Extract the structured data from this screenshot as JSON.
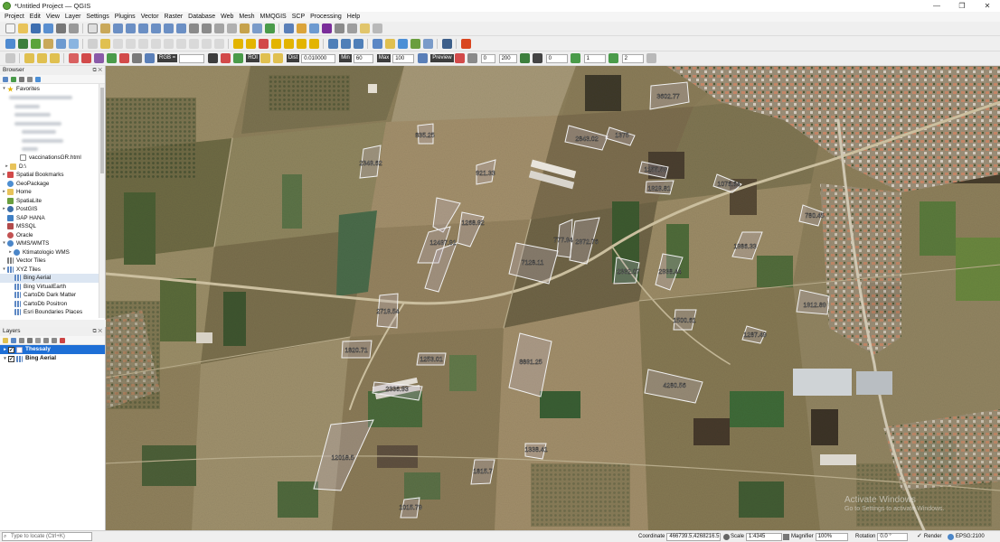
{
  "window": {
    "title": "*Untitled Project — QGIS",
    "controls": [
      "—",
      "❐",
      "✕"
    ]
  },
  "menu": [
    "Project",
    "Edit",
    "View",
    "Layer",
    "Settings",
    "Plugins",
    "Vector",
    "Raster",
    "Database",
    "Web",
    "Mesh",
    "MMQGIS",
    "SCP",
    "Processing",
    "Help"
  ],
  "scp_toolbar": {
    "band_set": "RGB =",
    "roi_label": "ROI",
    "dist_label": "Dist",
    "dist_value": "0.010000",
    "min_label": "Min",
    "min_value": "60",
    "max_label": "Max",
    "max_value": "100",
    "preview_label": "Preview",
    "val_a": "0",
    "val_b": "200",
    "val_c": "0",
    "val_d": "1",
    "val_e": "2"
  },
  "browser": {
    "title": "Browser",
    "items": [
      {
        "label": "Favorites",
        "level": 0,
        "expand": "▾",
        "icon": "star-icon",
        "color": "#e3b400"
      },
      {
        "label": "vaccinationsGR.html",
        "level": 2,
        "expand": "",
        "icon": "file-icon",
        "color": "#8a8a8a"
      },
      {
        "label": "D:\\",
        "level": 0,
        "expand": "▸",
        "icon": "folder-icon",
        "color": "#e8c35a"
      },
      {
        "label": "Spatial Bookmarks",
        "level": 0,
        "expand": "▸",
        "icon": "bookmark-icon",
        "color": "#d24a4a"
      },
      {
        "label": "GeoPackage",
        "level": 0,
        "expand": "",
        "icon": "geopackage-icon",
        "color": "#4d8ed1"
      },
      {
        "label": "Home",
        "level": 0,
        "expand": "▸",
        "icon": "folder-icon",
        "color": "#e8c35a"
      },
      {
        "label": "SpatiaLite",
        "level": 0,
        "expand": "",
        "icon": "spatialite-icon",
        "color": "#6a9e3f"
      },
      {
        "label": "PostGIS",
        "level": 0,
        "expand": "▸",
        "icon": "postgis-icon",
        "color": "#3d6fa8"
      },
      {
        "label": "SAP HANA",
        "level": 0,
        "expand": "",
        "icon": "database-icon",
        "color": "#3f7fc4"
      },
      {
        "label": "MSSQL",
        "level": 0,
        "expand": "",
        "icon": "database-icon",
        "color": "#b24b4b"
      },
      {
        "label": "Oracle",
        "level": 0,
        "expand": "",
        "icon": "database-icon",
        "color": "#c25252"
      },
      {
        "label": "WMS/WMTS",
        "level": 0,
        "expand": "▾",
        "icon": "globe-icon",
        "color": "#4b86c8"
      },
      {
        "label": "Ktimatologio WMS",
        "level": 1,
        "expand": "▸",
        "icon": "globe-icon",
        "color": "#4b86c8"
      },
      {
        "label": "Vector Tiles",
        "level": 0,
        "expand": "",
        "icon": "grid-icon",
        "color": "#7d7d7d"
      },
      {
        "label": "XYZ Tiles",
        "level": 0,
        "expand": "▾",
        "icon": "grid-icon",
        "color": "#5d88c4"
      },
      {
        "label": "Bing Aerial",
        "level": 1,
        "expand": "",
        "icon": "grid-icon",
        "color": "#5d88c4",
        "selected": true
      },
      {
        "label": "Bing VirtualEarth",
        "level": 1,
        "expand": "",
        "icon": "grid-icon",
        "color": "#5d88c4"
      },
      {
        "label": "CartoDb Dark Matter",
        "level": 1,
        "expand": "",
        "icon": "grid-icon",
        "color": "#5d88c4"
      },
      {
        "label": "CartoDb Positron",
        "level": 1,
        "expand": "",
        "icon": "grid-icon",
        "color": "#5d88c4"
      },
      {
        "label": "Esri Boundaries Places",
        "level": 1,
        "expand": "",
        "icon": "grid-icon",
        "color": "#5d88c4"
      }
    ]
  },
  "layers_panel": {
    "title": "Layers",
    "layers": [
      {
        "name": "Thessaly",
        "active": true
      },
      {
        "name": "Bing Aerial",
        "active": false
      }
    ]
  },
  "parcels": [
    "3602.77",
    "835.25",
    "2843.02",
    "1375",
    "2349.62",
    "1255.59",
    "921.33",
    "1929.81",
    "1076.64",
    "1268.92",
    "780.45",
    "12497.91",
    "777.94",
    "2972.76",
    "1986.33",
    "7128.11",
    "2332.07",
    "2938.44",
    "1912.89",
    "2719.54",
    "1500.61",
    "1287.49",
    "1820.71",
    "1253.01",
    "8891.25",
    "4280.56",
    "2336.93",
    "12018.5",
    "1338.41",
    "1815.7",
    "1015.79"
  ],
  "status": {
    "locator_placeholder": "Type to locate (Ctrl+K)",
    "coordinate_label": "Coordinate",
    "coordinate": "466739.5,4268216.5",
    "scale_label": "Scale",
    "scale": "1:4345",
    "magnifier_label": "Magnifier",
    "magnifier": "100%",
    "rotation_label": "Rotation",
    "rotation": "0.0 °",
    "render_label": "Render",
    "crs": "EPSG:2100"
  },
  "watermark": {
    "line1": "Activate Windows",
    "line2": "Go to Settings to activate Windows."
  }
}
